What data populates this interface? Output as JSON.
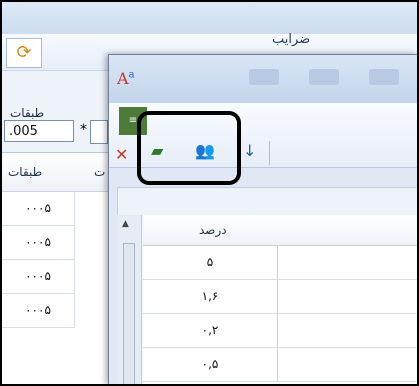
{
  "background_window": {
    "title": "ضرایب",
    "field_label": "طبقات",
    "field_value": ".005",
    "operator": "*",
    "grid": {
      "headers": [
        "طبقات",
        "ت"
      ],
      "rows": [
        "۰۰۰۵",
        "۰۰۰۵",
        "۰۰۰۵",
        "۰۰۰۵"
      ]
    }
  },
  "dialog": {
    "side_tab_label": "≡",
    "icons": [
      "text-size-icon",
      "truck-icon",
      "users-icon",
      "sort-down-icon",
      "close-x-icon"
    ],
    "table": {
      "header": "درصد",
      "rows": [
        "۵",
        "۱,۶",
        "۰,۲",
        "۰,۵"
      ]
    }
  }
}
